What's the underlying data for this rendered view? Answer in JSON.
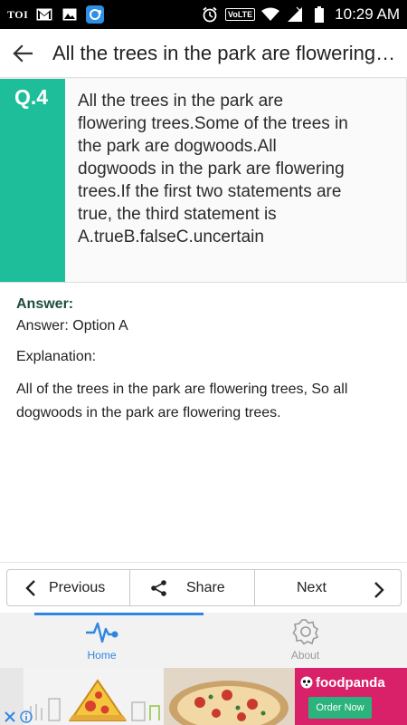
{
  "status_bar": {
    "carrier": "TOI",
    "network_badge": "VoLTE",
    "time": "10:29 AM",
    "icons": [
      "gmail-icon",
      "image-icon",
      "sync-app-icon",
      "alarm-icon",
      "wifi-icon",
      "signal-icon",
      "battery-icon"
    ]
  },
  "app_bar": {
    "title": "All the trees in the park are flowering trees.Some of the trees in the park are dogwoods.All dogwoods in the park are flowering trees."
  },
  "question": {
    "number": "Q.4",
    "text": "All the trees in the park are flowering trees.Some of the trees in the park are dogwoods.All dogwoods in the park are flowering trees.If the first two statements are true, the third statement is A.trueB.falseC.uncertain"
  },
  "answer": {
    "heading": "Answer:",
    "option": "Answer: Option A",
    "explanation_heading": "Explanation:",
    "explanation": "All of the trees in the park are flowering trees, So all dogwoods in the park are flowering trees."
  },
  "nav": {
    "previous": "Previous",
    "share": "Share",
    "next": "Next"
  },
  "tabs": {
    "home": "Home",
    "about": "About"
  },
  "ad": {
    "brand": "foodpanda",
    "cta": "Order Now"
  },
  "colors": {
    "accent_teal": "#1fbe9a",
    "tab_active": "#2f86e0",
    "answer_heading": "#1f4d3c",
    "ad_brand_bg": "#d9216a",
    "ad_cta_bg": "#2bb37c"
  }
}
